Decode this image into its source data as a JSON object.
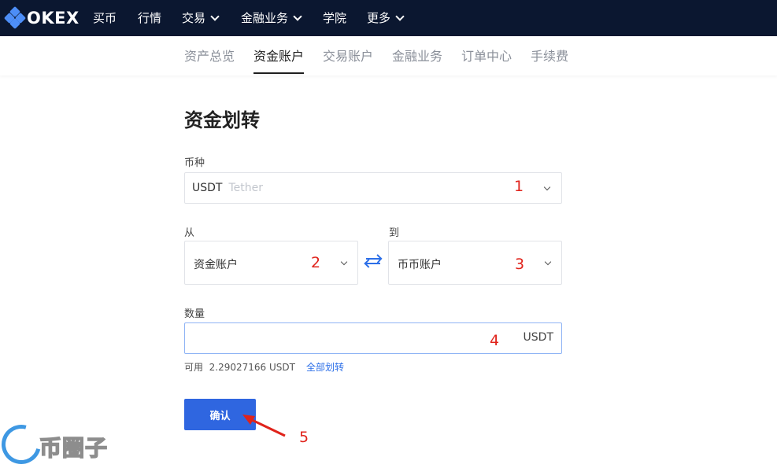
{
  "topnav": {
    "logo_text": "OKEX",
    "items": [
      {
        "label": "买币",
        "has_dropdown": false
      },
      {
        "label": "行情",
        "has_dropdown": false
      },
      {
        "label": "交易",
        "has_dropdown": true
      },
      {
        "label": "金融业务",
        "has_dropdown": true
      },
      {
        "label": "学院",
        "has_dropdown": false
      },
      {
        "label": "更多",
        "has_dropdown": true
      }
    ]
  },
  "subnav": {
    "tabs": [
      {
        "label": "资产总览",
        "active": false
      },
      {
        "label": "资金账户",
        "active": true
      },
      {
        "label": "交易账户",
        "active": false
      },
      {
        "label": "金融业务",
        "active": false
      },
      {
        "label": "订单中心",
        "active": false
      },
      {
        "label": "手续费",
        "active": false
      }
    ]
  },
  "form": {
    "title": "资金划转",
    "currency": {
      "label": "币种",
      "value": "USDT",
      "sub": "Tether",
      "step": "1"
    },
    "from": {
      "label": "从",
      "value": "资金账户",
      "step": "2"
    },
    "to": {
      "label": "到",
      "value": "币币账户",
      "step": "3"
    },
    "amount": {
      "label": "数量",
      "value": "",
      "unit": "USDT",
      "step": "4"
    },
    "available": {
      "label": "可用",
      "value": "2.29027166 USDT",
      "link": "全部划转"
    },
    "confirm_label": "确认",
    "confirm_step": "5"
  },
  "watermark": {
    "text": "币圈子"
  },
  "colors": {
    "nav_bg": "#0b1730",
    "accent": "#2f66e0",
    "annotation": "#e0231b"
  },
  "icons": [
    "okex-logo-icon",
    "chevron-down-icon",
    "swap-arrows-icon",
    "red-arrow-icon"
  ]
}
